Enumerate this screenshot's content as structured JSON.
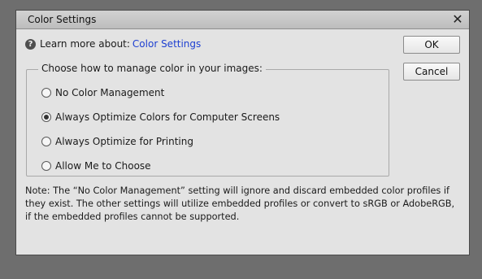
{
  "dialog": {
    "title": "Color Settings",
    "close_icon": "close-icon"
  },
  "help": {
    "icon": "question-icon",
    "label": "Learn more about:",
    "link_text": "Color Settings"
  },
  "group": {
    "legend": "Choose how to manage color in your images:",
    "options": [
      {
        "label": "No Color Management",
        "checked": false
      },
      {
        "label": "Always Optimize Colors for Computer Screens",
        "checked": true
      },
      {
        "label": "Always Optimize for Printing",
        "checked": false
      },
      {
        "label": "Allow Me to Choose",
        "checked": false
      }
    ]
  },
  "note": "Note: The “No Color Management” setting will ignore and discard embedded color profiles if they exist. The other settings will utilize embedded profiles or convert to sRGB or AdobeRGB, if the embedded profiles cannot be supported.",
  "buttons": {
    "ok_label": "OK",
    "cancel_label": "Cancel"
  },
  "colors": {
    "link": "#1d3fd1",
    "backdrop": "#6e6e6e",
    "dialog_bg": "#e3e3e3"
  }
}
